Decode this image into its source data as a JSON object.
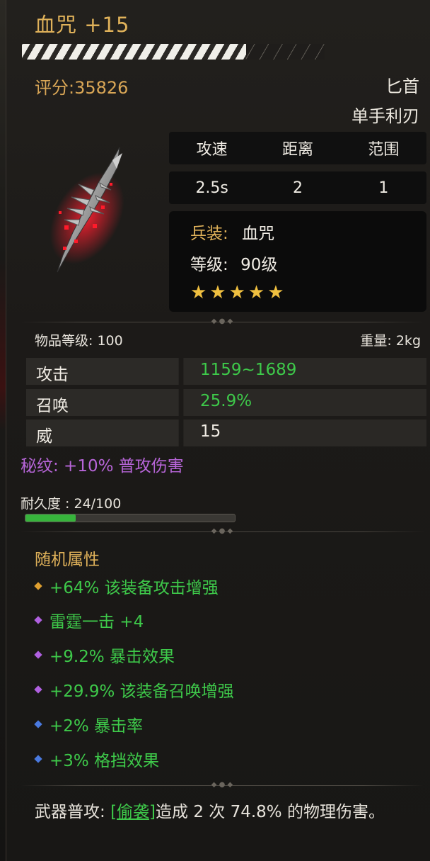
{
  "item": {
    "name": "血咒 +15",
    "score": "评分:35826",
    "weapon_type": "匕首",
    "weapon_subtype": "单手利刃",
    "durability_stripes_fraction": 0.74
  },
  "stats_table": {
    "headers": [
      "攻速",
      "距离",
      "范围"
    ],
    "values": [
      "2.5s",
      "2",
      "1"
    ]
  },
  "info": {
    "set_label": "兵装:",
    "set_value": "血咒",
    "level_label": "等级:",
    "level_value": "90级",
    "stars": "★★★★★",
    "star_count": 5
  },
  "meta": {
    "item_level": "物品等级: 100",
    "weight": "重量: 2kg"
  },
  "attributes": [
    {
      "label": "攻击",
      "value": "1159~1689",
      "color": "#3ec94a"
    },
    {
      "label": "召唤",
      "value": "25.9%",
      "color": "#3ec94a"
    },
    {
      "label": "威",
      "value": "15",
      "color": "#f0ece4"
    }
  ],
  "rune": "秘纹: +10% 普攻伤害",
  "durability": {
    "text": "耐久度 : 24/100",
    "fraction": 0.24
  },
  "random": {
    "title": "随机属性",
    "items": [
      {
        "text": "+64% 该装备攻击增强",
        "gem_color": "#e0a030"
      },
      {
        "text": "雷霆一击 +4",
        "gem_color": "#b060e0"
      },
      {
        "text": "+9.2% 暴击效果",
        "gem_color": "#b060e0"
      },
      {
        "text": "+29.9% 该装备召唤增强",
        "gem_color": "#b060e0"
      },
      {
        "text": "+2% 暴击率",
        "gem_color": "#4a7ae0"
      },
      {
        "text": "+3% 格挡效果",
        "gem_color": "#4a7ae0"
      }
    ]
  },
  "footer": {
    "prefix": "武器普攻:",
    "skill": "[偷袭]",
    "suffix": "造成 2 次 74.8% 的物理伤害。"
  }
}
